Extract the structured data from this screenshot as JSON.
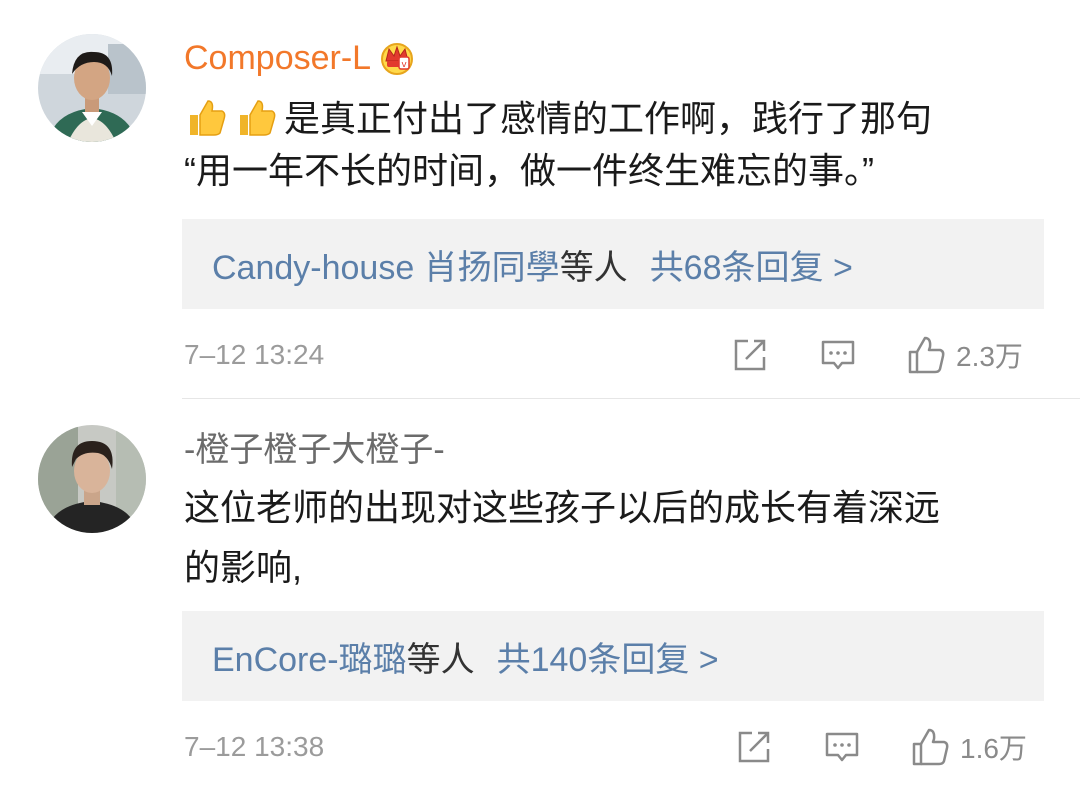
{
  "comments": [
    {
      "username": "Composer-L",
      "text_line1": "是真正付出了感情的工作啊，践行了那句",
      "text_line2": "“用一年不长的时间，做一件终生难忘的事。”",
      "reply_users": "Candy-house 肖扬同學",
      "reply_suffix": "等人",
      "reply_count": "共68条回复 >",
      "timestamp": "7–12 13:24",
      "likes": "2.3万"
    },
    {
      "username": "-橙子橙子大橙子-",
      "text_line1": "这位老师的出现对这些孩子以后的成长有着深远",
      "text_line2": "的影响,",
      "reply_users": "EnCore-璐璐",
      "reply_suffix": "等人",
      "reply_count": "共140条回复 >",
      "timestamp": "7–12 13:38",
      "likes": "1.6万"
    }
  ],
  "icons": {
    "share": "share-icon",
    "comment": "comment-icon",
    "like": "thumbs-up-icon",
    "crown": "crown-badge-icon",
    "emoji": "thumbs-up-emoji"
  },
  "colors": {
    "vip_name": "#f2782a",
    "link": "#5b7fa9",
    "reply_bg": "#f2f2f2",
    "meta": "#9b9b9b"
  }
}
